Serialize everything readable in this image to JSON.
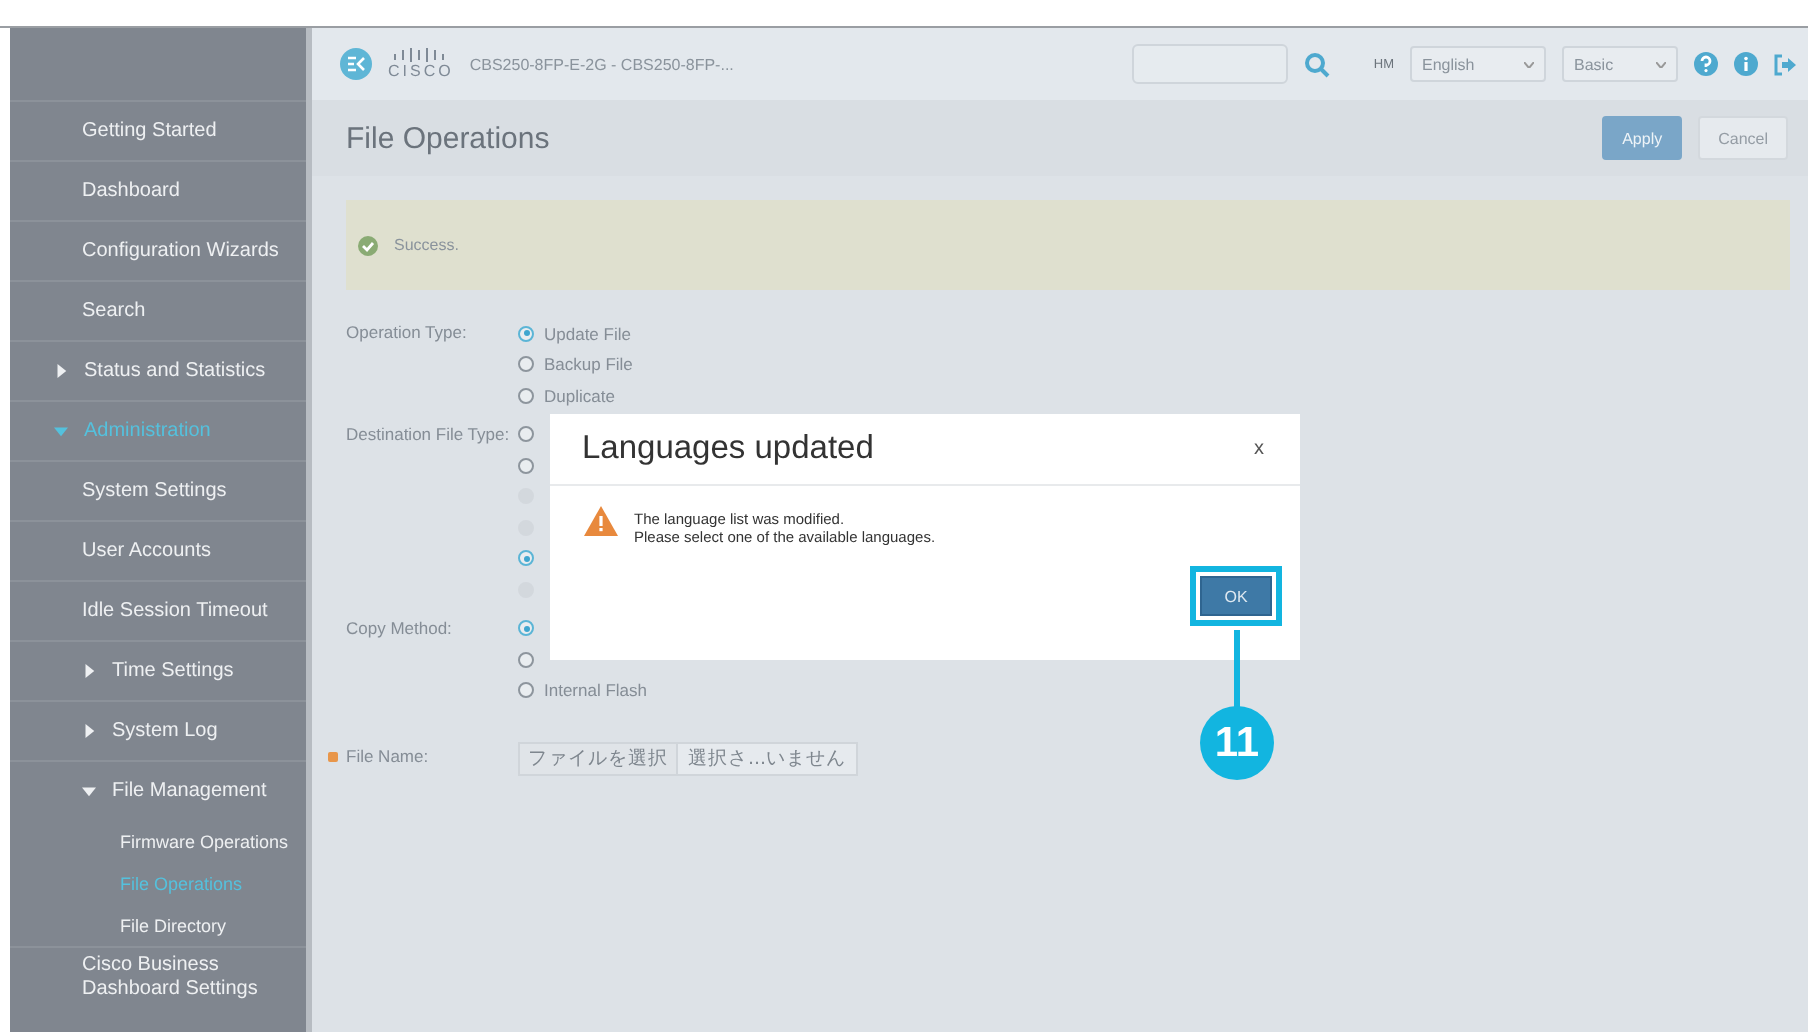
{
  "header": {
    "logo_text": "CISCO",
    "device": "CBS250-8FP-E-2G - CBS250-8FP-...",
    "hm_label": "HM",
    "language": "English",
    "mode": "Basic"
  },
  "sidebar": [
    {
      "label": "Getting Started",
      "kind": "item",
      "selected": false
    },
    {
      "label": "Dashboard",
      "kind": "item",
      "selected": false
    },
    {
      "label": "Configuration Wizards",
      "kind": "item",
      "selected": false
    },
    {
      "label": "Search",
      "kind": "item",
      "selected": false
    },
    {
      "label": "Status and Statistics",
      "kind": "group",
      "expanded": false,
      "selected": false
    },
    {
      "label": "Administration",
      "kind": "group",
      "expanded": true,
      "selected": true,
      "children": [
        {
          "label": "System Settings",
          "kind": "item",
          "selected": false
        },
        {
          "label": "User Accounts",
          "kind": "item",
          "selected": false
        },
        {
          "label": "Idle Session Timeout",
          "kind": "item",
          "selected": false
        },
        {
          "label": "Time Settings",
          "kind": "group",
          "expanded": false,
          "selected": false
        },
        {
          "label": "System Log",
          "kind": "group",
          "expanded": false,
          "selected": false
        },
        {
          "label": "File Management",
          "kind": "group",
          "expanded": true,
          "selected": false,
          "children": [
            {
              "label": "Firmware Operations",
              "kind": "sub",
              "selected": false
            },
            {
              "label": "File Operations",
              "kind": "sub",
              "selected": true
            },
            {
              "label": "File Directory",
              "kind": "sub",
              "selected": false
            }
          ]
        },
        {
          "label": "Cisco Business Dashboard Settings",
          "kind": "item",
          "selected": false
        }
      ]
    }
  ],
  "page_title": "File Operations",
  "buttons": [
    {
      "label": "Apply",
      "kind": "primary"
    },
    {
      "label": "Cancel",
      "kind": "secondary"
    }
  ],
  "banner": {
    "text": "Success."
  },
  "form": [
    {
      "label": "Operation Type:",
      "kind": "radio",
      "options": [
        {
          "label": "Update File",
          "selected": true,
          "disabled": false
        },
        {
          "label": "Backup File",
          "selected": false,
          "disabled": false
        },
        {
          "label": "Duplicate",
          "selected": false,
          "disabled": false
        }
      ]
    },
    {
      "label": "Destination File Type:",
      "kind": "radio",
      "options": [
        {
          "selected": false,
          "disabled": false
        },
        {
          "selected": false,
          "disabled": false
        },
        {
          "selected": false,
          "disabled": true
        },
        {
          "selected": false,
          "disabled": true
        },
        {
          "selected": true,
          "disabled": false
        },
        {
          "selected": false,
          "disabled": true
        }
      ]
    },
    {
      "label": "Copy Method:",
      "kind": "radio",
      "options": [
        {
          "selected": true,
          "disabled": false
        },
        {
          "selected": false,
          "disabled": false
        },
        {
          "label": "Internal Flash",
          "selected": false,
          "disabled": false
        }
      ]
    },
    {
      "label": "File Name:",
      "kind": "file",
      "required": true,
      "button": "ファイルを選択",
      "status": "選択さ...いません"
    }
  ],
  "dialog": {
    "title": "Languages updated",
    "close": "x",
    "message": [
      "The language list was modified.",
      "Please select one of the available languages."
    ],
    "ok": "OK"
  },
  "callout": {
    "number": "11"
  }
}
